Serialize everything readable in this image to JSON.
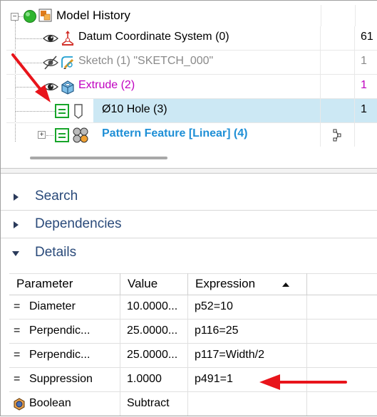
{
  "model_history": {
    "root_label": "Model History",
    "items": [
      {
        "label": "Datum Coordinate System (0)",
        "value": "61",
        "style": "normal"
      },
      {
        "label": "Sketch (1) \"SKETCH_000\"",
        "value": "1",
        "style": "gray"
      },
      {
        "label": "Extrude (2)",
        "value": "1",
        "style": "magenta"
      },
      {
        "label": "Ø10 Hole (3)",
        "value": "1",
        "style": "selected"
      },
      {
        "label": "Pattern Feature [Linear] (4)",
        "value": "",
        "style": "blue"
      }
    ]
  },
  "sections": {
    "search": "Search",
    "dependencies": "Dependencies",
    "details": "Details"
  },
  "details_table": {
    "headers": {
      "parameter": "Parameter",
      "value": "Value",
      "expression": "Expression"
    },
    "rows": [
      {
        "parameter": "Diameter",
        "value": "10.0000...",
        "expression": "p52=10"
      },
      {
        "parameter": "Perpendic...",
        "value": "25.0000...",
        "expression": "p116=25"
      },
      {
        "parameter": "Perpendic...",
        "value": "25.0000...",
        "expression": "p117=Width/2"
      },
      {
        "parameter": "Suppression",
        "value": "1.0000",
        "expression": "p491=1"
      },
      {
        "parameter": "Boolean",
        "value": "Subtract",
        "expression": ""
      }
    ]
  },
  "icons": {
    "eye": "eye-icon",
    "eye_hidden": "eye-hidden-icon",
    "datum_csys": "datum-csys-icon",
    "sketch": "sketch-icon",
    "extrude": "extrude-icon",
    "hole": "hole-icon",
    "pattern": "pattern-icon",
    "suppress_box": "suppression-icon",
    "boolean": "boolean-icon",
    "red_arrow": "annotation-arrow"
  },
  "colors": {
    "selected_row": "#cce8f4",
    "magenta_text": "#c000c0",
    "blue_text": "#1e8fd6",
    "gray_text": "#8a8a8a",
    "section_title": "#2a4a7a",
    "annotation_red": "#e8141b"
  }
}
